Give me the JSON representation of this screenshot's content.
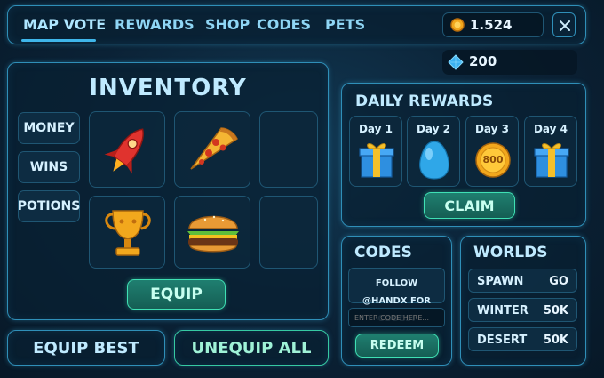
{
  "nav": {
    "tabs": [
      "MAP VOTE",
      "REWARDS",
      "SHOP",
      "CODES",
      "PETS"
    ],
    "active_tab": "MAP VOTE",
    "coins": "1.524",
    "gems": "200",
    "close_icon": "close-icon"
  },
  "inventory": {
    "title": "INVENTORY",
    "categories": [
      "MONEY",
      "WINS",
      "POTIONS"
    ],
    "items": [
      "rocket-icon",
      "pizza-icon",
      "",
      "trophy-icon",
      "burger-icon",
      ""
    ],
    "equip_label": "EQUIP"
  },
  "actions": {
    "equip_best": "EQUIP BEST",
    "unequip_all": "UNEQUIP ALL"
  },
  "daily_rewards": {
    "title": "DAILY REWARDS",
    "days": [
      {
        "label": "Day 1",
        "icon": "gift-icon"
      },
      {
        "label": "Day 2",
        "icon": "egg-icon"
      },
      {
        "label": "Day 3",
        "icon": "coin-icon",
        "coin_text": "800"
      },
      {
        "label": "Day 4",
        "icon": "gift-icon"
      }
    ],
    "claim_label": "CLAIM"
  },
  "codes": {
    "title": "CODES",
    "message": "FOLLOW @HANDX FOR CODES!",
    "placeholder": "ENTER CODE HERE...",
    "redeem_label": "REDEEM"
  },
  "worlds": {
    "title": "WORLDS",
    "rows": [
      {
        "name": "SPAWN",
        "action": "GO"
      },
      {
        "name": "WINTER",
        "action": "50K"
      },
      {
        "name": "DESERT",
        "action": "50K"
      }
    ]
  },
  "colors": {
    "accent": "#3fe0b4",
    "border": "#2f8fb8",
    "coin": "#f2a81d",
    "gem": "#3ab0f0"
  }
}
